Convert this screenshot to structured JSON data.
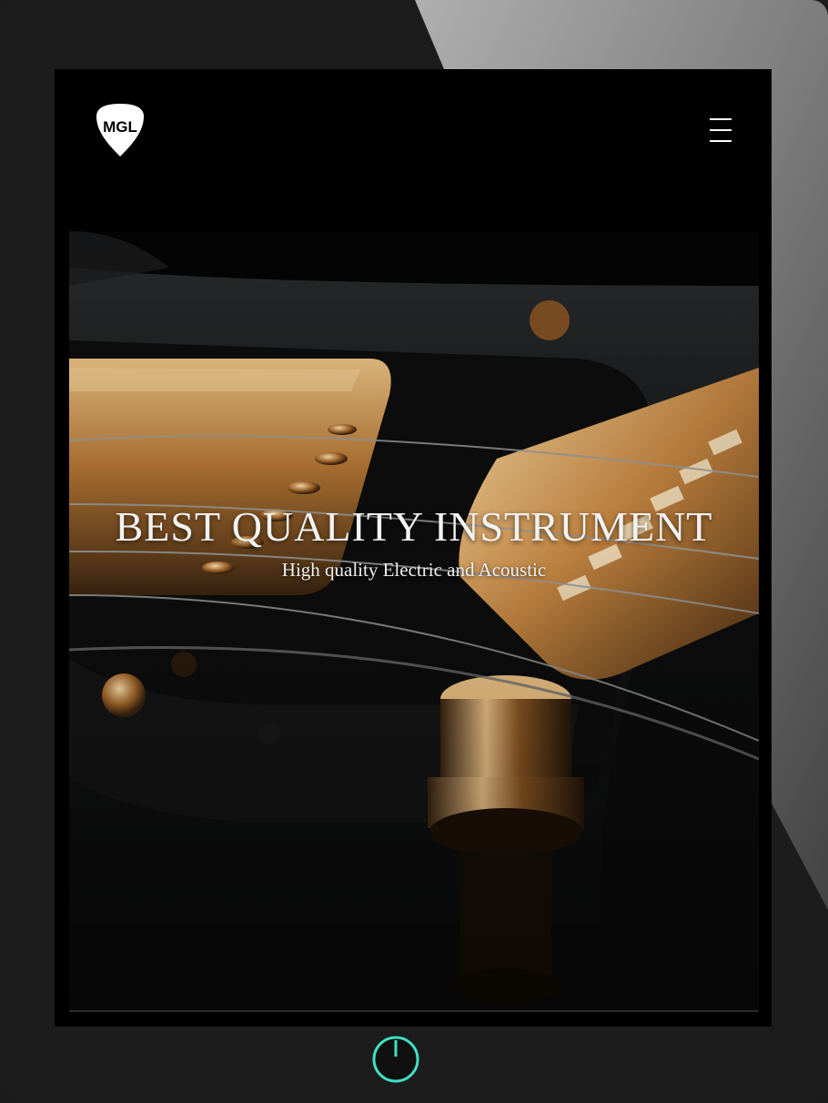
{
  "device": {
    "frame_color": "#1c1c1c",
    "power_icon": "power-icon",
    "power_color": "#3fe0c5"
  },
  "header": {
    "logo_text": "MGL",
    "logo_icon": "guitar-pick-logo",
    "menu_icon": "hamburger-menu-icon"
  },
  "hero": {
    "title": "BEST QUALITY INSTRUMENT",
    "subtitle": "High quality Electric and Acoustic",
    "image": "gold-guitar-bridge-closeup",
    "accent_color": "#c8893f"
  }
}
